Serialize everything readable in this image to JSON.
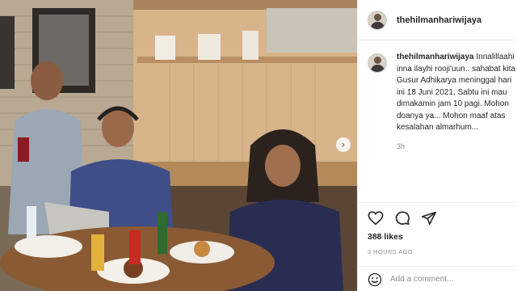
{
  "post": {
    "username": "thehilmanhariwijaya",
    "caption": {
      "username": "thehilmanhariwijaya",
      "text": "Innalillaahi inna ilayhi rooji'uun.. sahabat kita Gusur Adhikarya meninggal hari ini 18 Juni 2021, Sabtu ini mau dimakamin jam 10 pagi. Mohon doanya ya... Mohon maaf atas kesalahan almarhum...",
      "time": "3h"
    },
    "likes": "388 likes",
    "posted_ago": "3 HOURS AGO",
    "comment_placeholder": "Add a comment..."
  },
  "icons": {
    "like": "heart-icon",
    "comment": "comment-bubble-icon",
    "share": "paper-plane-icon",
    "emoji": "smiley-icon",
    "next": "chevron-right-icon"
  }
}
